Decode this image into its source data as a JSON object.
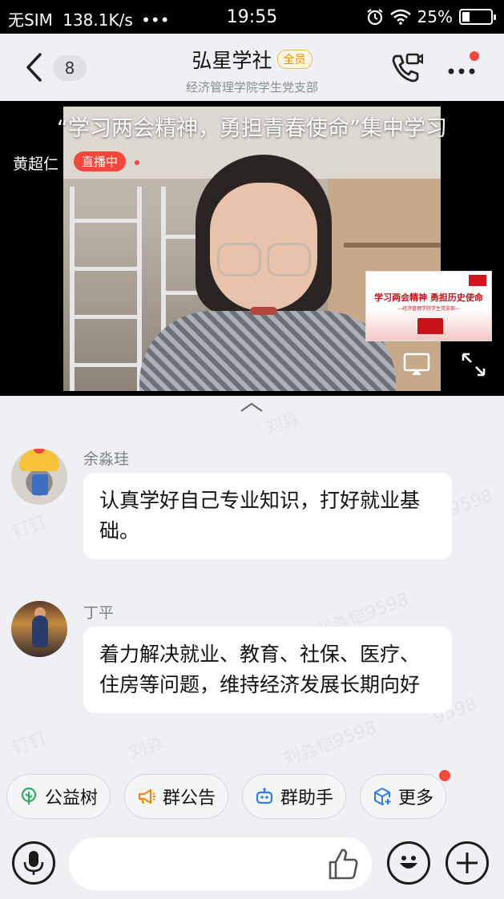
{
  "status_bar": {
    "carrier": "无SIM",
    "network_speed": "138.1K/s",
    "dots": "•••",
    "time": "19:55",
    "battery": "25%",
    "battery_level": 0.25
  },
  "header": {
    "unread_count": "8",
    "title": "弘星学社",
    "title_badge": "全员",
    "subtitle": "经济管理学院学生党支部"
  },
  "live": {
    "title": "“学习两会精神，勇担青春使命”集中学习",
    "presenter": "黄超仁",
    "status_badge": "直播中",
    "slide_title": "学习两会精神  勇担历史使命",
    "slide_subtitle": "—经济管理学院学生党支部—"
  },
  "watermarks": [
    "钉钉",
    "刘淼",
    "刘淼恺9598",
    "9598",
    "钉钉",
    "刘淼",
    "刘淼恺9598",
    "9598"
  ],
  "messages": [
    {
      "sender": "余淼珪",
      "text": "认真学好自己专业知识，打好就业基础。"
    },
    {
      "sender": "丁平",
      "text": "着力解决就业、教育、社保、医疗、住房等问题，维持经济发展长期向好"
    }
  ],
  "quick_actions": [
    {
      "label": "公益树",
      "icon": "tree-icon",
      "color": "#2fae5f"
    },
    {
      "label": "群公告",
      "icon": "megaphone-icon",
      "color": "#f08a00"
    },
    {
      "label": "群助手",
      "icon": "robot-icon",
      "color": "#2d7cf0"
    },
    {
      "label": "更多",
      "icon": "cube-plus-icon",
      "color": "#2d7cf0"
    }
  ],
  "colors": {
    "accent_red": "#f4483d",
    "badge_orange": "#f08a00",
    "background": "#eef0f3"
  }
}
